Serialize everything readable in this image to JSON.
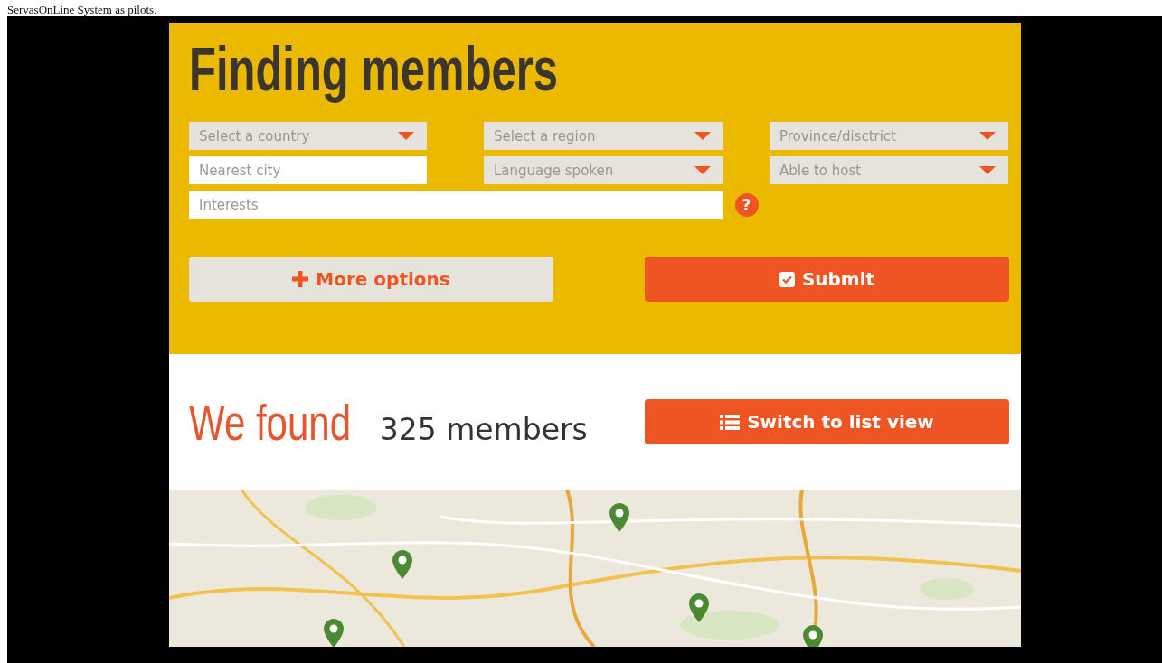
{
  "caption": "ServasOnLine System as pilots.",
  "search_panel": {
    "title": "Finding members",
    "fields": [
      {
        "kind": "select",
        "placeholder": "Select a country"
      },
      {
        "kind": "select",
        "placeholder": "Select a region"
      },
      {
        "kind": "select",
        "placeholder": "Province/disctrict"
      },
      {
        "kind": "text",
        "placeholder": "Nearest city"
      },
      {
        "kind": "select",
        "placeholder": "Language spoken"
      },
      {
        "kind": "select",
        "placeholder": "Able to host"
      },
      {
        "kind": "wide_text",
        "placeholder": "Interests"
      }
    ],
    "help": "?",
    "buttons": [
      {
        "kind": "secondary",
        "label": "More options"
      },
      {
        "kind": "primary",
        "label": "Submit"
      }
    ]
  },
  "results": {
    "title": "We found",
    "count": "325 members",
    "button": {
      "label": "Switch to list view"
    }
  }
}
